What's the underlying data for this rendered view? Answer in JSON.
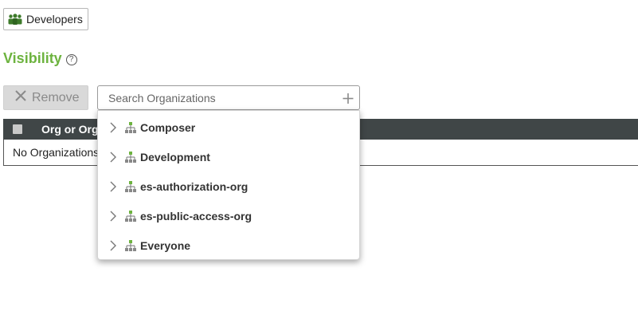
{
  "group": {
    "label": "Developers",
    "icon": "people-group-icon",
    "icon_color": "#3d7a2a"
  },
  "visibility": {
    "title": "Visibility",
    "help_icon": "help-circle-icon",
    "help_glyph": "?",
    "title_color": "#6db33f"
  },
  "toolbar": {
    "remove_label": "Remove",
    "remove_icon": "close-icon"
  },
  "search": {
    "placeholder": "Search Organizations",
    "value": "",
    "add_icon": "plus-icon"
  },
  "table": {
    "columns": [
      "Org or Org"
    ],
    "empty_message": "No Organizations",
    "header_color": "#404647"
  },
  "dropdown": {
    "items": [
      {
        "label": "Composer"
      },
      {
        "label": "Development"
      },
      {
        "label": "es-authorization-org"
      },
      {
        "label": "es-public-access-org"
      },
      {
        "label": "Everyone"
      }
    ],
    "item_icon": "org-hierarchy-icon",
    "expand_icon": "chevron-right-icon"
  }
}
